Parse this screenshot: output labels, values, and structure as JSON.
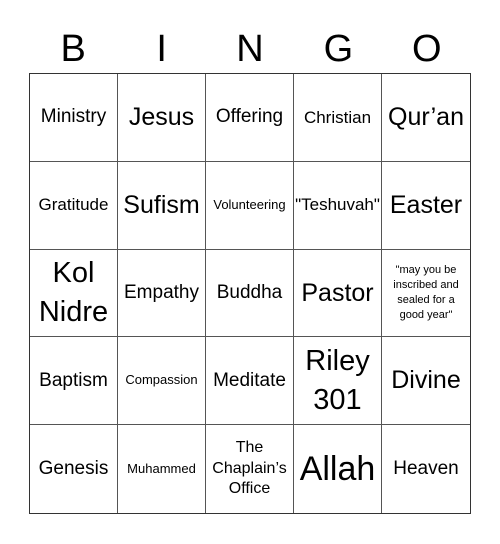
{
  "header": [
    "B",
    "I",
    "N",
    "G",
    "O"
  ],
  "cells": [
    {
      "text": "Ministry",
      "size": "m"
    },
    {
      "text": "Jesus",
      "size": "l"
    },
    {
      "text": "Offering",
      "size": "m"
    },
    {
      "text": "Christian",
      "size": "ms"
    },
    {
      "text": "Qur’an",
      "size": "l"
    },
    {
      "text": "Gratitude",
      "size": "ms"
    },
    {
      "text": "Sufism",
      "size": "l"
    },
    {
      "text": "Volunteering",
      "size": "s"
    },
    {
      "text": "\"Teshuvah\"",
      "size": "ms"
    },
    {
      "text": "Easter",
      "size": "l"
    },
    {
      "text": "Kol Nidre",
      "size": "xl"
    },
    {
      "text": "Empathy",
      "size": "m"
    },
    {
      "text": "Buddha",
      "size": "m"
    },
    {
      "text": "Pastor",
      "size": "l"
    },
    {
      "text": "\"may you be inscribed and sealed for a good year\"",
      "size": "xs"
    },
    {
      "text": "Baptism",
      "size": "m"
    },
    {
      "text": "Compassion",
      "size": "s"
    },
    {
      "text": "Meditate",
      "size": "m"
    },
    {
      "text": "Riley 301",
      "size": "xl"
    },
    {
      "text": "Divine",
      "size": "l"
    },
    {
      "text": "Genesis",
      "size": "m"
    },
    {
      "text": "Muhammed",
      "size": "s"
    },
    {
      "text": "The Chaplain’s Office",
      "size": "ms"
    },
    {
      "text": "Allah",
      "size": "xxl"
    },
    {
      "text": "Heaven",
      "size": "m"
    }
  ]
}
